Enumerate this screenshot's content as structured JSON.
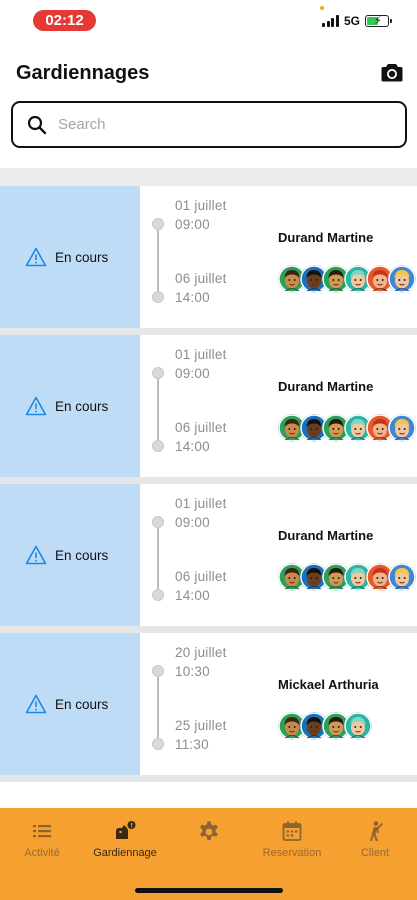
{
  "status_bar": {
    "time": "02:12",
    "network": "5G"
  },
  "header": {
    "title": "Gardiennages"
  },
  "search": {
    "placeholder": "Search",
    "value": ""
  },
  "gardiennages": [
    {
      "status": "En cours",
      "start_date": "01 juillet",
      "start_time": "09:00",
      "end_date": "06 juillet",
      "end_time": "14:00",
      "client": "Durand Martine",
      "avatar_count": 6
    },
    {
      "status": "En cours",
      "start_date": "01 juillet",
      "start_time": "09:00",
      "end_date": "06 juillet",
      "end_time": "14:00",
      "client": "Durand Martine",
      "avatar_count": 6
    },
    {
      "status": "En cours",
      "start_date": "01 juillet",
      "start_time": "09:00",
      "end_date": "06 juillet",
      "end_time": "14:00",
      "client": "Durand Martine",
      "avatar_count": 6
    },
    {
      "status": "En cours",
      "start_date": "20 juillet",
      "start_time": "10:30",
      "end_date": "25 juillet",
      "end_time": "11:30",
      "client": "Mickael Arthuria",
      "avatar_count": 4
    }
  ],
  "bottom_nav": {
    "active": "gardiennage",
    "items": [
      {
        "id": "activite",
        "label": "Activité",
        "icon": "list-icon"
      },
      {
        "id": "gardiennage",
        "label": "Gardiennage",
        "icon": "dog-badge-icon"
      },
      {
        "id": "settings",
        "label": "",
        "icon": "gear-icon"
      },
      {
        "id": "reservation",
        "label": "Reservation",
        "icon": "calendar-icon"
      },
      {
        "id": "client",
        "label": "Client",
        "icon": "walker-icon"
      }
    ]
  },
  "colors": {
    "accent": "#f5a030",
    "status_cell": "#bfdcf7",
    "warning": "#1e88e5",
    "time_pill": "#e53935"
  }
}
